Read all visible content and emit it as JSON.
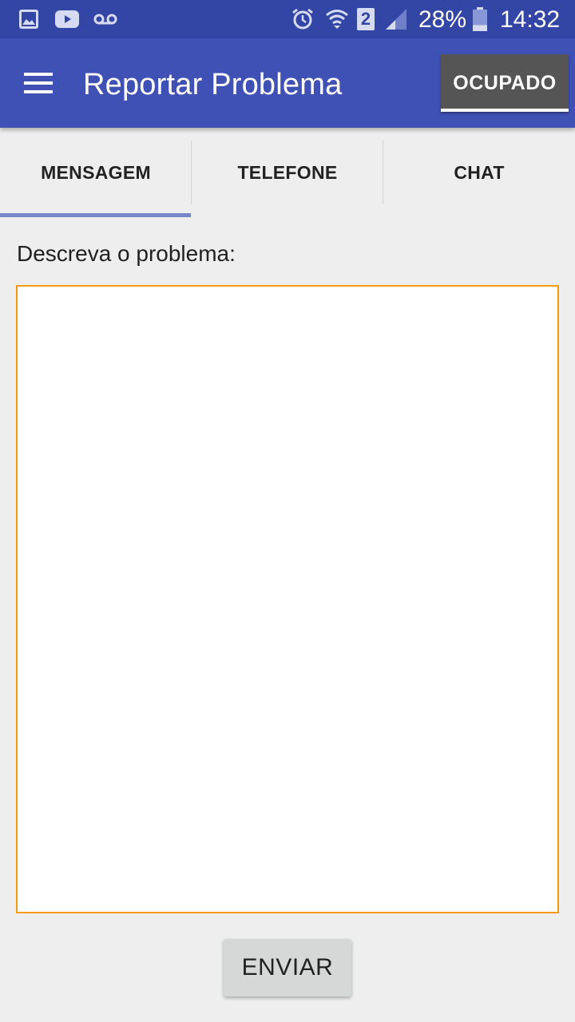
{
  "status_bar": {
    "icons": [
      "gallery-icon",
      "youtube-icon",
      "voicemail-icon",
      "alarm-icon",
      "wifi-icon",
      "sim-2-icon",
      "cell-signal-icon",
      "battery-icon"
    ],
    "sim_number": "2",
    "battery": "28%",
    "battery_level": 0.28,
    "time": "14:32"
  },
  "app_bar": {
    "menu_icon": "hamburger-menu-icon",
    "title": "Reportar Problema",
    "status_button": "OCUPADO"
  },
  "tabs": [
    {
      "label": "MENSAGEM",
      "selected": true
    },
    {
      "label": "TELEFONE",
      "selected": false
    },
    {
      "label": "CHAT",
      "selected": false
    }
  ],
  "form": {
    "label": "Descreva o problema:",
    "message_value": "",
    "message_placeholder": "",
    "send_button": "ENVIAR"
  },
  "colors": {
    "status_bar": "#3346a6",
    "app_bar": "#3f51b5",
    "tab_indicator": "#7986cb",
    "input_border": "#f39c12",
    "status_button": "#555555"
  }
}
